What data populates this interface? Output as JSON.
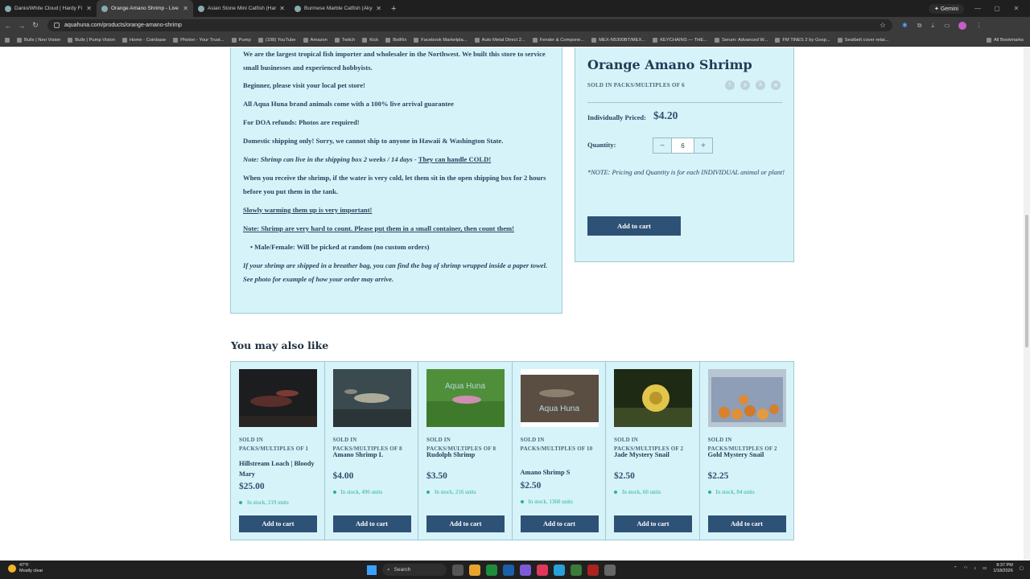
{
  "tabs": [
    {
      "title": "Danio/White Cloud | Hardy Fi",
      "active": false
    },
    {
      "title": "Orange Amano Shrimp - Live F",
      "active": true
    },
    {
      "title": "Asian Stone Mini Catfish (Hara",
      "active": false
    },
    {
      "title": "Burmese Marble Catfish (Akysi",
      "active": false
    }
  ],
  "browser": {
    "url": "aquahuna.com/products/orange-amano-shrimp",
    "gemini_label": "Gemini",
    "new_tab": "+",
    "all_bookmarks": "All Bookmarks"
  },
  "bookmarks": [
    "Bullx | Neo Vision",
    "Bullx | Pump Vision",
    "Home - Coinbase",
    "Photon - Your Trust...",
    "Pump",
    "(108) YouTube",
    "Amazon",
    "Twitch",
    "Kick",
    "BotRix",
    "Facebook Marketpla...",
    "Auto Metal Direct 2...",
    "Fender & Compone...",
    "MEX-N5300BT/MEX...",
    "KEYCHAINS — THE...",
    "Serum: Advanced W...",
    "FM TiNES 2 by Gosp...",
    "Seatbelt cover retai..."
  ],
  "description": {
    "p1": "We are the largest tropical fish importer and wholesaler in the Northwest.  We built this store to service small businesses and experienced hobbyists.",
    "p2": "Beginner, please visit your local pet store!",
    "p3": "All Aqua Huna brand animals come with a 100% live arrival guarantee",
    "p4": "For DOA refunds:  Photos are required!",
    "p5": "Domestic shipping only!  Sorry, we cannot ship to anyone in Hawaii & Washington State.",
    "p6a": "Note: Shrimp can live in the shipping box 2 weeks / 14 days - ",
    "p6b": "They can handle COLD!",
    "p7": "When you receive the shrimp, if the water is very cold, let them sit in the open shipping box for 2 hours before you put them in the tank.",
    "p8": "Slowly warming them up is very important!",
    "p9": "Note:  Shrimp are very hard to count.  Please put them in a small container, then count them!",
    "p10": "Male/Female: Will be picked at random (no custom orders)",
    "p11": "If your shrimp are shipped in a breather bag, you can find the bag of shrimp wrupped inside a paper towel. See photo for example of how your order may arrive."
  },
  "product": {
    "title": "Orange Amano Shrimp",
    "packs": "SOLD IN PACKS/MULTIPLES OF 6",
    "price_label": "Individually Priced:",
    "price": "$4.20",
    "quantity_label": "Quantity:",
    "quantity": "6",
    "minus": "−",
    "plus": "+",
    "note": "*NOTE: Pricing and Quantity is for each INDIVIDUAL animal or plant!",
    "add_to_cart": "Add to cart",
    "share_icons": [
      "facebook-icon",
      "pinterest-icon",
      "x-icon",
      "email-icon"
    ]
  },
  "related": {
    "title": "You may also like",
    "items": [
      {
        "packs": "SOLD IN PACKS/MULTIPLES OF 1",
        "name": "Hillstream Loach | Bloody Mary",
        "price": "$25.00",
        "stock": "In stock, 219 units",
        "cta": "Add to cart"
      },
      {
        "packs": "SOLD IN PACKS/MULTIPLES OF 8",
        "name": "Amano Shrimp L",
        "price": "$4.00",
        "stock": "In stock, 496 units",
        "cta": "Add to cart"
      },
      {
        "packs": "SOLD IN PACKS/MULTIPLES OF 8",
        "name": "Rudolph Shrimp",
        "price": "$3.50",
        "stock": "In stock, 216 units",
        "cta": "Add to cart",
        "watermark": "Aqua Huna"
      },
      {
        "packs": "SOLD IN PACKS/MULTIPLES OF 10",
        "name": "Amano Shrimp S",
        "price": "$2.50",
        "stock": "In stock, 1360 units",
        "cta": "Add to cart",
        "watermark": "Aqua Huna"
      },
      {
        "packs": "SOLD IN PACKS/MULTIPLES OF 2",
        "name": "Jade Mystery Snail",
        "price": "$2.50",
        "stock": "In stock, 66 units",
        "cta": "Add to cart"
      },
      {
        "packs": "SOLD IN PACKS/MULTIPLES OF 2",
        "name": "Gold Mystery Snail",
        "price": "$2.25",
        "stock": "In stock, 84 units",
        "cta": "Add to cart"
      }
    ]
  },
  "taskbar": {
    "temp": "47°F",
    "weather": "Mostly clear",
    "search": "Search",
    "time": "8:37 PM",
    "date": "1/18/2026"
  },
  "colors": {
    "panel_bg": "#d6f3f9",
    "button": "#2e5176",
    "stock_green": "#27b38f",
    "heading": "#1f3d55"
  }
}
